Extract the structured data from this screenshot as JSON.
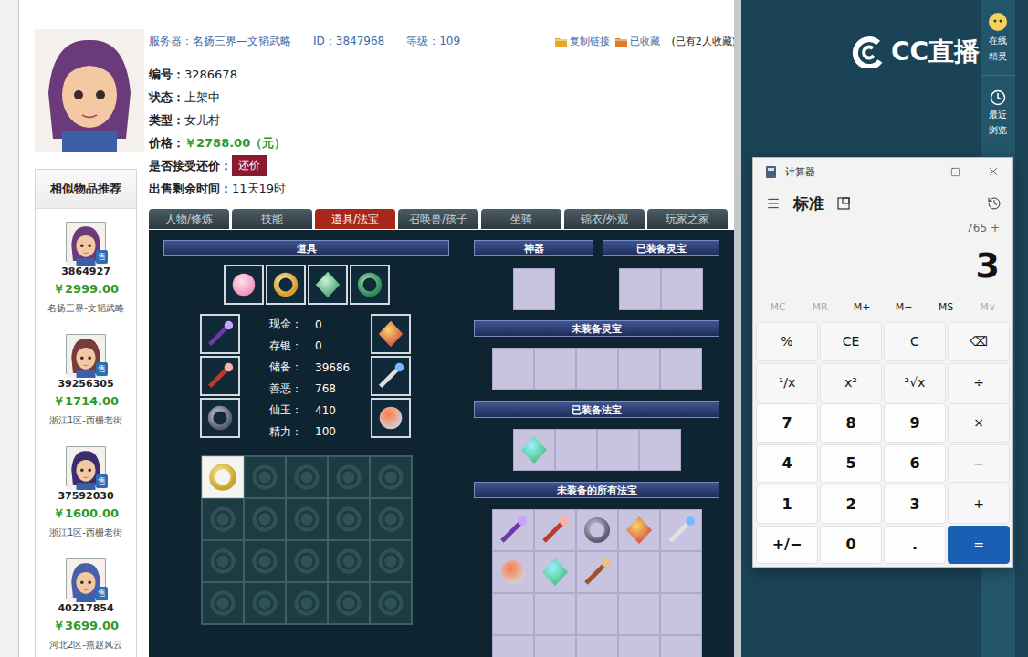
{
  "page": {
    "header": {
      "server": "服务器：名扬三界—文韬武略",
      "id": "ID：3847968",
      "level": "等级：109",
      "copy_link": "复制链接",
      "favorited": "已收藏",
      "favorite_count": "(已有2人收藏)"
    },
    "info": [
      {
        "label": "编号：",
        "value": "3286678",
        "kind": "plain"
      },
      {
        "label": "状态：",
        "value": "上架中",
        "kind": "plain"
      },
      {
        "label": "类型：",
        "value": "女儿村",
        "kind": "plain"
      },
      {
        "label": "价格：",
        "value": "￥2788.00（元）",
        "kind": "price"
      },
      {
        "label": "是否接受还价：",
        "value": "还价",
        "kind": "button"
      },
      {
        "label": "出售剩余时间：",
        "value": "11天19时",
        "kind": "plain"
      }
    ],
    "similar": {
      "title": "相似物品推荐",
      "items": [
        {
          "id": "3864927",
          "price": "￥2999.00",
          "server": "名扬三界-文韬武略",
          "badge": "售"
        },
        {
          "id": "39256305",
          "price": "￥1714.00",
          "server": "浙江1区-西栅老街",
          "badge": "售"
        },
        {
          "id": "37592030",
          "price": "￥1600.00",
          "server": "浙江1区-西栅老街",
          "badge": "售"
        },
        {
          "id": "40217854",
          "price": "￥3699.00",
          "server": "河北2区-燕赵风云",
          "badge": "售"
        }
      ]
    },
    "tabs": [
      {
        "label": "人物/修炼",
        "selected": false
      },
      {
        "label": "技能",
        "selected": false
      },
      {
        "label": "道具/法宝",
        "selected": true
      },
      {
        "label": "召唤兽/孩子",
        "selected": false
      },
      {
        "label": "坐骑",
        "selected": false
      },
      {
        "label": "锦衣/外观",
        "selected": false
      },
      {
        "label": "玩家之家",
        "selected": false
      }
    ],
    "props": {
      "title": "道具",
      "top_items": [
        {
          "filled": true
        },
        {
          "filled": true
        },
        {
          "filled": true
        },
        {
          "filled": true
        }
      ],
      "left_equip": [
        {
          "filled": true
        },
        {
          "filled": true
        },
        {
          "filled": true
        }
      ],
      "right_equip": [
        {
          "filled": true
        },
        {
          "filled": true
        },
        {
          "filled": true
        }
      ],
      "stats": [
        {
          "label": "现金：",
          "value": "0"
        },
        {
          "label": "存银：",
          "value": "0"
        },
        {
          "label": "储备：",
          "value": "39686"
        },
        {
          "label": "善恶：",
          "value": "768"
        },
        {
          "label": "仙玉：",
          "value": "410"
        },
        {
          "label": "精力：",
          "value": "100"
        }
      ],
      "bag": [
        {
          "filled": true
        },
        {
          "filled": false
        },
        {
          "filled": false
        },
        {
          "filled": false
        },
        {
          "filled": false
        },
        {
          "filled": false
        },
        {
          "filled": false
        },
        {
          "filled": false
        },
        {
          "filled": false
        },
        {
          "filled": false
        },
        {
          "filled": false
        },
        {
          "filled": false
        },
        {
          "filled": false
        },
        {
          "filled": false
        },
        {
          "filled": false
        },
        {
          "filled": false
        },
        {
          "filled": false
        },
        {
          "filled": false
        },
        {
          "filled": false
        },
        {
          "filled": false
        }
      ]
    },
    "treasures": {
      "artifact": {
        "title": "神器",
        "slots": [
          {
            "filled": false
          }
        ]
      },
      "lingbao_equipped": {
        "title": "已装备灵宝",
        "slots": [
          {
            "filled": false
          },
          {
            "filled": false
          }
        ]
      },
      "lingbao_unequipped": {
        "title": "未装备灵宝",
        "slots": [
          {
            "filled": false
          },
          {
            "filled": false
          },
          {
            "filled": false
          },
          {
            "filled": false
          },
          {
            "filled": false
          }
        ]
      },
      "fabao_equipped": {
        "title": "已装备法宝",
        "slots": [
          {
            "filled": true
          },
          {
            "filled": false
          },
          {
            "filled": false
          },
          {
            "filled": false
          }
        ]
      },
      "fabao_all": {
        "title": "未装备的所有法宝",
        "slots": [
          {
            "filled": true
          },
          {
            "filled": true
          },
          {
            "filled": true
          },
          {
            "filled": true
          },
          {
            "filled": true
          },
          {
            "filled": true
          },
          {
            "filled": true
          },
          {
            "filled": true
          },
          {
            "filled": false
          },
          {
            "filled": false
          },
          {
            "filled": false
          },
          {
            "filled": false
          },
          {
            "filled": false
          },
          {
            "filled": false
          },
          {
            "filled": false
          },
          {
            "filled": false
          },
          {
            "filled": false
          },
          {
            "filled": false
          },
          {
            "filled": false
          },
          {
            "filled": false
          }
        ]
      }
    }
  },
  "side_rail": [
    {
      "lines": [
        "在线",
        "精灵"
      ]
    },
    {
      "lines": [
        "最近",
        "浏览"
      ]
    }
  ],
  "watermark": "CC直播",
  "calculator": {
    "title": "计算器",
    "mode": "标准",
    "expression": "765 +",
    "display": "3",
    "memory": [
      {
        "label": "MC",
        "disabled": true
      },
      {
        "label": "MR",
        "disabled": true
      },
      {
        "label": "M+",
        "disabled": false
      },
      {
        "label": "M−",
        "disabled": false
      },
      {
        "label": "MS",
        "disabled": false
      },
      {
        "label": "M∨",
        "disabled": true
      }
    ],
    "keys": [
      {
        "label": "%",
        "kind": "fn"
      },
      {
        "label": "CE",
        "kind": "fn"
      },
      {
        "label": "C",
        "kind": "fn"
      },
      {
        "label": "⌫",
        "kind": "fn"
      },
      {
        "label": "¹/x",
        "kind": "fn"
      },
      {
        "label": "x²",
        "kind": "fn"
      },
      {
        "label": "²√x",
        "kind": "fn"
      },
      {
        "label": "÷",
        "kind": "fn"
      },
      {
        "label": "7",
        "kind": "num"
      },
      {
        "label": "8",
        "kind": "num"
      },
      {
        "label": "9",
        "kind": "num"
      },
      {
        "label": "×",
        "kind": "fn"
      },
      {
        "label": "4",
        "kind": "num"
      },
      {
        "label": "5",
        "kind": "num"
      },
      {
        "label": "6",
        "kind": "num"
      },
      {
        "label": "−",
        "kind": "fn"
      },
      {
        "label": "1",
        "kind": "num"
      },
      {
        "label": "2",
        "kind": "num"
      },
      {
        "label": "3",
        "kind": "num"
      },
      {
        "label": "+",
        "kind": "fn"
      },
      {
        "label": "+/−",
        "kind": "num"
      },
      {
        "label": "0",
        "kind": "num"
      },
      {
        "label": ".",
        "kind": "num"
      },
      {
        "label": "=",
        "kind": "eq"
      }
    ]
  }
}
